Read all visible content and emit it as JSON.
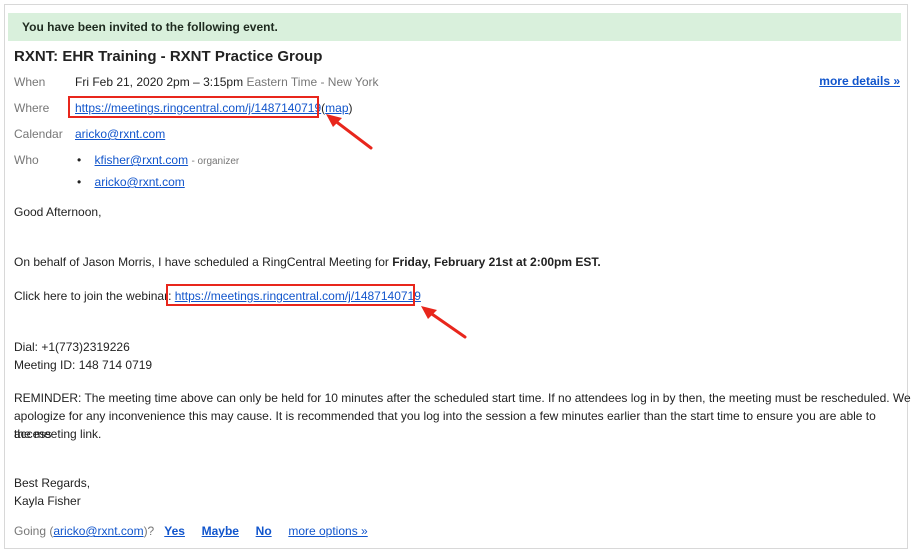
{
  "banner": "You have been invited to the following event.",
  "event": {
    "title": "RXNT: EHR Training - RXNT Practice Group",
    "when_label": "When",
    "when_value": "Fri Feb 21, 2020 2pm – 3:15pm",
    "timezone": "Eastern Time - New York",
    "more_details": "more details »",
    "where_label": "Where",
    "where_link": "https://meetings.ringcentral.com/j/1487140719",
    "map_open": "(",
    "map_label": "map",
    "map_close": ")",
    "calendar_label": "Calendar",
    "calendar_value": "aricko@rxnt.com",
    "who_label": "Who",
    "attendees": [
      {
        "email": "kfisher@rxnt.com",
        "role": "- organizer"
      },
      {
        "email": "aricko@rxnt.com",
        "role": ""
      }
    ]
  },
  "message": {
    "greeting": "Good Afternoon,",
    "intro": "On behalf of Jason Morris, I have scheduled a RingCentral Meeting for ",
    "intro_bold": "Friday, February 21st at 2:00pm EST.",
    "join_text": "Click here to join the webinar: ",
    "join_link": "https://meetings.ringcentral.com/j/1487140719",
    "dial": "Dial: +1(773)2319226",
    "meeting_id": "Meeting ID: 148 714 0719",
    "reminder_1": "REMINDER:  The meeting time above can only be held for 10 minutes after the scheduled start time.  If no attendees log in by then, the meeting must be rescheduled.  We",
    "reminder_2": "apologize for any inconvenience this may cause. It is recommended that you log into the session a few minutes earlier than the start time to ensure you are able to access",
    "reminder_3": "the meeting link.",
    "regards": "Best Regards,",
    "signature": "Kayla Fisher"
  },
  "rsvp": {
    "going_prefix": "Going (",
    "email": "aricko@rxnt.com",
    "going_suffix": ")?",
    "yes": "Yes",
    "maybe": "Maybe",
    "no": "No",
    "more_options": "more options »"
  },
  "colors": {
    "annotation": "#e8261c",
    "link": "#1155cc",
    "banner_bg": "#d9f0dc"
  }
}
